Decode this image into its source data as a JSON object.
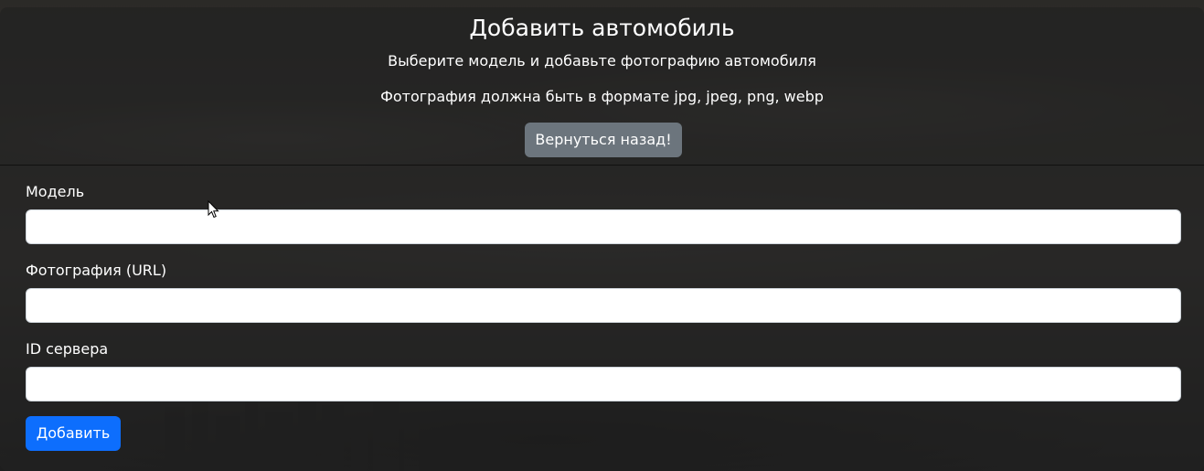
{
  "page": {
    "title": "Добавить автомобиль",
    "subtitle": "Выберите модель и добавьте фотографию автомобиля",
    "format_hint": "Фотография должна быть в формате jpg, jpeg, png, webp",
    "back_button_label": "Вернуться назад!"
  },
  "form": {
    "model": {
      "label": "Модель",
      "value": "",
      "placeholder": ""
    },
    "photo_url": {
      "label": "Фотография (URL)",
      "value": "",
      "placeholder": ""
    },
    "server_id": {
      "label": "ID сервера",
      "value": "",
      "placeholder": ""
    },
    "submit_label": "Добавить"
  },
  "colors": {
    "primary_button": "#0d6efd",
    "secondary_button": "#6c757d",
    "text": "#ffffff"
  },
  "icons": {
    "mouse_cursor": "arrow-cursor-icon"
  }
}
